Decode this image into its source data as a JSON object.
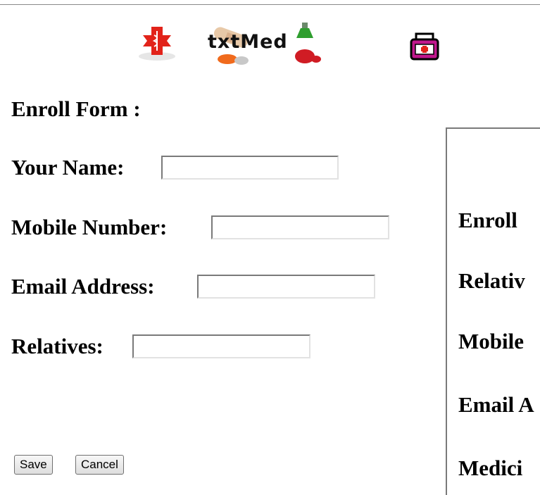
{
  "logo": {
    "text": "txtMed"
  },
  "form": {
    "title": "Enroll Form :",
    "name_label": "Your Name:",
    "name_value": "",
    "mobile_label": "Mobile Number:",
    "mobile_value": "",
    "email_label": "Email Address:",
    "email_value": "",
    "relatives_label": "Relatives:",
    "relatives_value": "",
    "save_label": "Save",
    "cancel_label": "Cancel"
  },
  "panel": {
    "line1": "Enroll",
    "line2": "Relativ",
    "line3": "Mobile",
    "line4": "Email A",
    "line5": "Medici"
  },
  "colors": {
    "accent_red": "#e2231a",
    "bottle_magenta": "#c0178c",
    "bottle_green": "#2f9e2f"
  }
}
